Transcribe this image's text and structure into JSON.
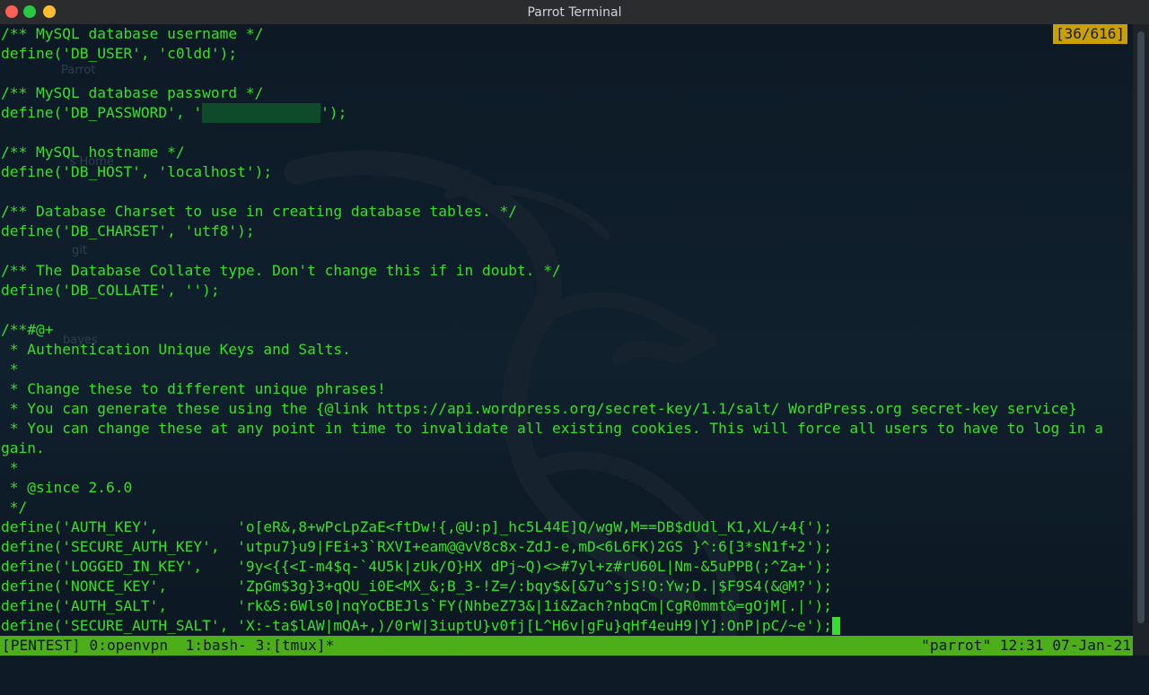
{
  "window": {
    "title": "Parrot Terminal",
    "buttons": [
      {
        "name": "close",
        "color": "#ff5f57"
      },
      {
        "name": "zoom",
        "color": "#28c840"
      },
      {
        "name": "minimize",
        "color": "#ffbd2e"
      }
    ]
  },
  "desktop_ghosts": [
    "Parrot",
    "'s Home",
    "git",
    "bayes"
  ],
  "terminal": {
    "position_indicator": "[36/616]",
    "lines": [
      "/** MySQL database username */",
      "define('DB_USER', 'c0ldd');",
      "",
      "/** MySQL database password */",
      "define('DB_PASSWORD', '",
      "",
      "/** MySQL hostname */",
      "define('DB_HOST', 'localhost');",
      "",
      "/** Database Charset to use in creating database tables. */",
      "define('DB_CHARSET', 'utf8');",
      "",
      "/** The Database Collate type. Don't change this if in doubt. */",
      "define('DB_COLLATE', '');",
      "",
      "/**#@+",
      " * Authentication Unique Keys and Salts.",
      " *",
      " * Change these to different unique phrases!",
      " * You can generate these using the {@link https://api.wordpress.org/secret-key/1.1/salt/ WordPress.org secret-key service}",
      " * You can change these at any point in time to invalidate all existing cookies. This will force all users to have to log in a",
      "gain.",
      " *",
      " * @since 2.6.0",
      " */",
      "define('AUTH_KEY',         'o[eR&,8+wPcLpZaE<ftDw!{,@U:p]_hc5L44E]Q/wgW,M==DB$dUdl_K1,XL/+4{');",
      "define('SECURE_AUTH_KEY',  'utpu7}u9|FEi+3`RXVI+eam@@vV8c8x-ZdJ-e,mD<6L6FK)2GS }^:6[3*sN1f+2');",
      "define('LOGGED_IN_KEY',    '9y<{{<I-m4$q-`4U5k|zUk/O}HX dPj~Q)<>#7yl+z#rU60L|Nm-&5uPPB(;^Za+');",
      "define('NONCE_KEY',        'ZpGm$3g}3+qQU_i0E<MX_&;B_3-!Z=/:bqy$&[&7u^sjS!O:Yw;D.|$F9S4(&@M?');",
      "define('AUTH_SALT',        'rk&S:6Wls0|nqYoCBEJls`FY(NhbeZ73&|1i&Zach?nbqCm|CgR0mmt&=gOjM[.|');",
      "define('SECURE_AUTH_SALT', 'X:-ta$lAW|mQA+,)/0rW|3iuptU}v0fj[L^H6v|gFu}qHf4euH9|Y]:OnP|pC/~e');"
    ],
    "password_line_tail": "');"
  },
  "tmux": {
    "left": "[PENTEST] 0:openvpn  1:bash- 3:[tmux]*",
    "right": "\"parrot\" 12:31 07-Jan-21"
  },
  "colors": {
    "text": "#35e02a",
    "status_bar": "#4caf19",
    "indicator": "#c9a000",
    "background": "#0e1b27"
  }
}
